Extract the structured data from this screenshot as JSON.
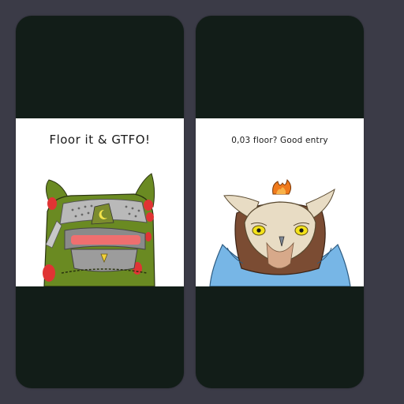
{
  "cards": [
    {
      "caption": "Floor it & GTFO!"
    },
    {
      "caption": "0,03 floor? Good entry"
    }
  ],
  "colors": {
    "page_background": "#3b3b47",
    "card_background": "#121d18",
    "panel_background": "#ffffff",
    "armor_green": "#6a8a22",
    "visor_red": "#ef6f6f",
    "owl_brown": "#7b4c33",
    "owl_face": "#e8dcc4",
    "owl_eye": "#f3e21b",
    "cloak_blue": "#77b6e6",
    "crown_orange": "#f07a1c"
  }
}
